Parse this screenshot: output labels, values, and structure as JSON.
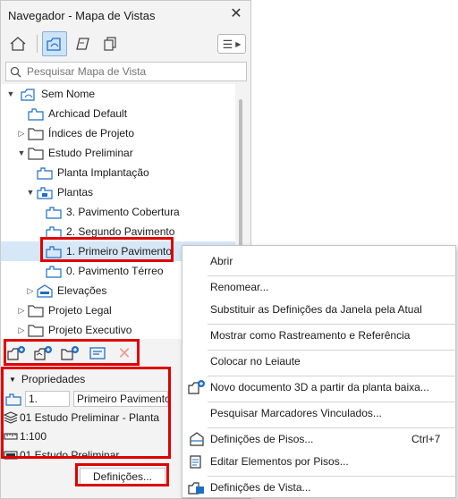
{
  "window": {
    "title": "Navegador - Mapa de Vistas"
  },
  "search": {
    "placeholder": "Pesquisar Mapa de Vista"
  },
  "tree": [
    {
      "label": "Sem Nome",
      "icon": "project-map-icon"
    },
    {
      "label": "Archicad Default",
      "icon": "view-folder-icon"
    },
    {
      "label": "Índices de Projeto",
      "icon": "folder-icon"
    },
    {
      "label": "Estudo Preliminar",
      "icon": "folder-icon"
    },
    {
      "label": "Planta Implantação",
      "icon": "view-icon"
    },
    {
      "label": "Plantas",
      "icon": "view-folder-icon"
    },
    {
      "label": "3. Pavimento Cobertura",
      "icon": "view-icon"
    },
    {
      "label": "2. Segundo Pavimento",
      "icon": "view-icon"
    },
    {
      "label": "1. Primeiro Pavimento",
      "icon": "view-icon"
    },
    {
      "label": "0. Pavimento Térreo",
      "icon": "view-icon"
    },
    {
      "label": "Elevações",
      "icon": "elevation-icon"
    },
    {
      "label": "Projeto Legal",
      "icon": "folder-icon"
    },
    {
      "label": "Projeto Executivo",
      "icon": "folder-icon"
    }
  ],
  "properties": {
    "header": "Propriedades",
    "id_value": "1.",
    "name_value": "Primeiro Pavimento",
    "layer_combo": "01 Estudo Preliminar - Planta",
    "scale": "1:100",
    "model_view": "01 Estudo Preliminar",
    "settings_button": "Definições..."
  },
  "context_menu": {
    "items": [
      {
        "label": "Abrir",
        "shortcut": ""
      },
      {
        "label": "Renomear...",
        "shortcut": ""
      },
      {
        "label": "Substituir as Definições da Janela pela Atual",
        "shortcut": ""
      },
      {
        "label": "Mostrar como Rastreamento e Referência",
        "shortcut": ""
      },
      {
        "label": "Colocar no Leiaute",
        "shortcut": ""
      },
      {
        "label": "Novo documento 3D a partir da planta baixa...",
        "shortcut": ""
      },
      {
        "label": "Pesquisar Marcadores Vinculados...",
        "shortcut": ""
      },
      {
        "label": "Definições de Pisos...",
        "shortcut": "Ctrl+7"
      },
      {
        "label": "Editar Elementos por Pisos...",
        "shortcut": ""
      },
      {
        "label": "Definições de Vista...",
        "shortcut": ""
      }
    ]
  },
  "colors": {
    "highlight": "#e00000",
    "accent": "#1f6fc5",
    "selected_row": "#d6e7f8"
  }
}
